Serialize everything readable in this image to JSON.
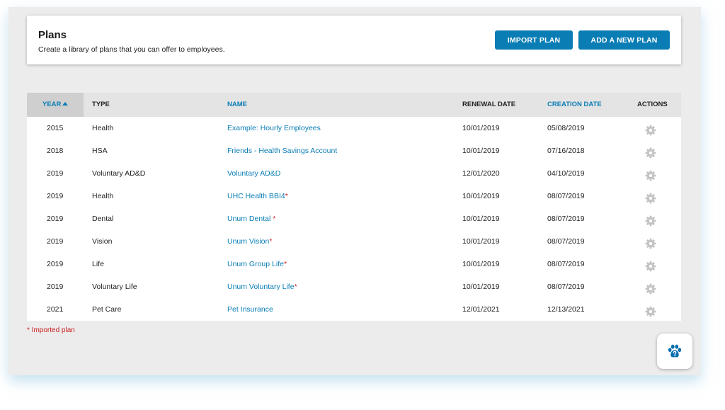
{
  "header": {
    "title": "Plans",
    "subtitle": "Create a library of plans that you can offer to employees.",
    "import_label": "IMPORT PLAN",
    "add_label": "ADD A NEW PLAN"
  },
  "table": {
    "columns": {
      "year": "YEAR",
      "type": "TYPE",
      "name": "NAME",
      "renewal": "RENEWAL DATE",
      "creation": "CREATION DATE",
      "actions": "ACTIONS"
    },
    "rows": [
      {
        "year": "2015",
        "type": "Health",
        "name": "Example: Hourly Employees",
        "imported": "",
        "renewal": "10/01/2019",
        "creation": "05/08/2019"
      },
      {
        "year": "2018",
        "type": "HSA",
        "name": "Friends - Health Savings Account",
        "imported": "",
        "renewal": "10/01/2019",
        "creation": "07/16/2018"
      },
      {
        "year": "2019",
        "type": "Voluntary AD&D",
        "name": "Voluntary AD&D",
        "imported": "",
        "renewal": "12/01/2020",
        "creation": "04/10/2019"
      },
      {
        "year": "2019",
        "type": "Health",
        "name": "UHC Health BBI4",
        "imported": "*",
        "renewal": "10/01/2019",
        "creation": "08/07/2019"
      },
      {
        "year": "2019",
        "type": "Dental",
        "name": "Unum Dental ",
        "imported": "*",
        "renewal": "10/01/2019",
        "creation": "08/07/2019"
      },
      {
        "year": "2019",
        "type": "Vision",
        "name": "Unum Vision",
        "imported": "*",
        "renewal": "10/01/2019",
        "creation": "08/07/2019"
      },
      {
        "year": "2019",
        "type": "Life",
        "name": "Unum Group Life",
        "imported": "*",
        "renewal": "10/01/2019",
        "creation": "08/07/2019"
      },
      {
        "year": "2019",
        "type": "Voluntary Life",
        "name": "Unum Voluntary Life",
        "imported": "*",
        "renewal": "10/01/2019",
        "creation": "08/07/2019"
      },
      {
        "year": "2021",
        "type": "Pet Care",
        "name": "Pet Insurance",
        "imported": "",
        "renewal": "12/01/2021",
        "creation": "12/13/2021"
      }
    ]
  },
  "footnote": "* Imported plan",
  "icons": {
    "row_action": "gear-icon",
    "help": "paw-question-icon",
    "sort": "sort-ascending-icon"
  },
  "colors": {
    "accent": "#0a7db5",
    "required": "#d0262e",
    "gear": "#c4c4c4"
  }
}
